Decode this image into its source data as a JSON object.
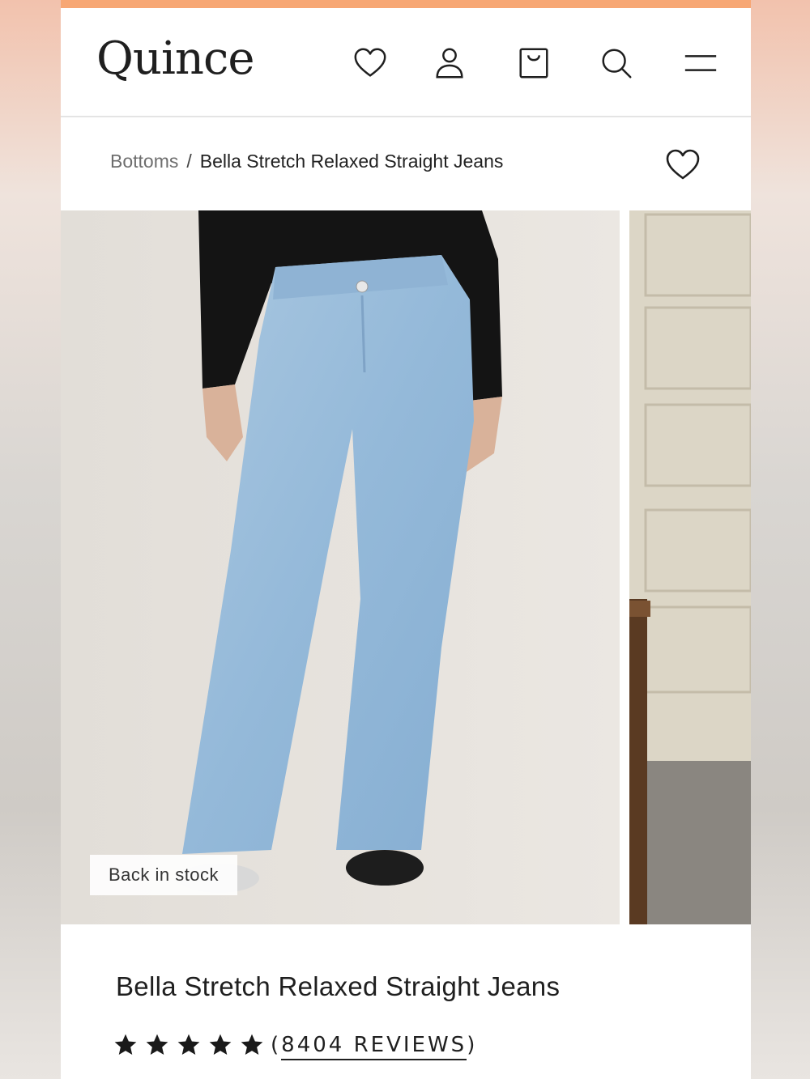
{
  "header": {
    "logo": "Quince",
    "icons": [
      "heart-icon",
      "account-icon",
      "bag-icon",
      "search-icon",
      "menu-icon"
    ]
  },
  "breadcrumb": {
    "parent": "Bottoms",
    "separator": "/",
    "current": "Bella Stretch Relaxed Straight Jeans"
  },
  "gallery": {
    "badge": "Back in stock"
  },
  "product": {
    "title": "Bella Stretch Relaxed Straight Jeans",
    "stars": 5,
    "reviews_open": "(",
    "reviews": "8404 REVIEWS",
    "reviews_close": ")"
  },
  "colors": {
    "accent": "#f7a774",
    "text": "#1f1f1f",
    "muted": "#6e6e6e"
  }
}
